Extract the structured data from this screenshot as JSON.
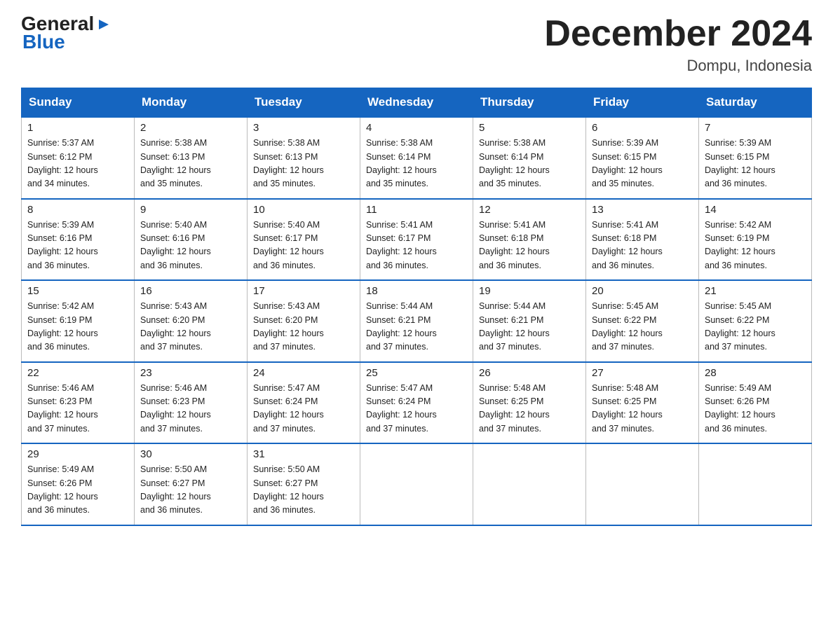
{
  "logo": {
    "line1": "General",
    "arrow": "▶",
    "line2": "Blue"
  },
  "title": {
    "month_year": "December 2024",
    "location": "Dompu, Indonesia"
  },
  "weekdays": [
    "Sunday",
    "Monday",
    "Tuesday",
    "Wednesday",
    "Thursday",
    "Friday",
    "Saturday"
  ],
  "weeks": [
    [
      {
        "day": "1",
        "sunrise": "5:37 AM",
        "sunset": "6:12 PM",
        "daylight": "12 hours and 34 minutes."
      },
      {
        "day": "2",
        "sunrise": "5:38 AM",
        "sunset": "6:13 PM",
        "daylight": "12 hours and 35 minutes."
      },
      {
        "day": "3",
        "sunrise": "5:38 AM",
        "sunset": "6:13 PM",
        "daylight": "12 hours and 35 minutes."
      },
      {
        "day": "4",
        "sunrise": "5:38 AM",
        "sunset": "6:14 PM",
        "daylight": "12 hours and 35 minutes."
      },
      {
        "day": "5",
        "sunrise": "5:38 AM",
        "sunset": "6:14 PM",
        "daylight": "12 hours and 35 minutes."
      },
      {
        "day": "6",
        "sunrise": "5:39 AM",
        "sunset": "6:15 PM",
        "daylight": "12 hours and 35 minutes."
      },
      {
        "day": "7",
        "sunrise": "5:39 AM",
        "sunset": "6:15 PM",
        "daylight": "12 hours and 36 minutes."
      }
    ],
    [
      {
        "day": "8",
        "sunrise": "5:39 AM",
        "sunset": "6:16 PM",
        "daylight": "12 hours and 36 minutes."
      },
      {
        "day": "9",
        "sunrise": "5:40 AM",
        "sunset": "6:16 PM",
        "daylight": "12 hours and 36 minutes."
      },
      {
        "day": "10",
        "sunrise": "5:40 AM",
        "sunset": "6:17 PM",
        "daylight": "12 hours and 36 minutes."
      },
      {
        "day": "11",
        "sunrise": "5:41 AM",
        "sunset": "6:17 PM",
        "daylight": "12 hours and 36 minutes."
      },
      {
        "day": "12",
        "sunrise": "5:41 AM",
        "sunset": "6:18 PM",
        "daylight": "12 hours and 36 minutes."
      },
      {
        "day": "13",
        "sunrise": "5:41 AM",
        "sunset": "6:18 PM",
        "daylight": "12 hours and 36 minutes."
      },
      {
        "day": "14",
        "sunrise": "5:42 AM",
        "sunset": "6:19 PM",
        "daylight": "12 hours and 36 minutes."
      }
    ],
    [
      {
        "day": "15",
        "sunrise": "5:42 AM",
        "sunset": "6:19 PM",
        "daylight": "12 hours and 36 minutes."
      },
      {
        "day": "16",
        "sunrise": "5:43 AM",
        "sunset": "6:20 PM",
        "daylight": "12 hours and 37 minutes."
      },
      {
        "day": "17",
        "sunrise": "5:43 AM",
        "sunset": "6:20 PM",
        "daylight": "12 hours and 37 minutes."
      },
      {
        "day": "18",
        "sunrise": "5:44 AM",
        "sunset": "6:21 PM",
        "daylight": "12 hours and 37 minutes."
      },
      {
        "day": "19",
        "sunrise": "5:44 AM",
        "sunset": "6:21 PM",
        "daylight": "12 hours and 37 minutes."
      },
      {
        "day": "20",
        "sunrise": "5:45 AM",
        "sunset": "6:22 PM",
        "daylight": "12 hours and 37 minutes."
      },
      {
        "day": "21",
        "sunrise": "5:45 AM",
        "sunset": "6:22 PM",
        "daylight": "12 hours and 37 minutes."
      }
    ],
    [
      {
        "day": "22",
        "sunrise": "5:46 AM",
        "sunset": "6:23 PM",
        "daylight": "12 hours and 37 minutes."
      },
      {
        "day": "23",
        "sunrise": "5:46 AM",
        "sunset": "6:23 PM",
        "daylight": "12 hours and 37 minutes."
      },
      {
        "day": "24",
        "sunrise": "5:47 AM",
        "sunset": "6:24 PM",
        "daylight": "12 hours and 37 minutes."
      },
      {
        "day": "25",
        "sunrise": "5:47 AM",
        "sunset": "6:24 PM",
        "daylight": "12 hours and 37 minutes."
      },
      {
        "day": "26",
        "sunrise": "5:48 AM",
        "sunset": "6:25 PM",
        "daylight": "12 hours and 37 minutes."
      },
      {
        "day": "27",
        "sunrise": "5:48 AM",
        "sunset": "6:25 PM",
        "daylight": "12 hours and 37 minutes."
      },
      {
        "day": "28",
        "sunrise": "5:49 AM",
        "sunset": "6:26 PM",
        "daylight": "12 hours and 36 minutes."
      }
    ],
    [
      {
        "day": "29",
        "sunrise": "5:49 AM",
        "sunset": "6:26 PM",
        "daylight": "12 hours and 36 minutes."
      },
      {
        "day": "30",
        "sunrise": "5:50 AM",
        "sunset": "6:27 PM",
        "daylight": "12 hours and 36 minutes."
      },
      {
        "day": "31",
        "sunrise": "5:50 AM",
        "sunset": "6:27 PM",
        "daylight": "12 hours and 36 minutes."
      },
      null,
      null,
      null,
      null
    ]
  ],
  "labels": {
    "sunrise": "Sunrise: ",
    "sunset": "Sunset: ",
    "daylight": "Daylight: "
  }
}
